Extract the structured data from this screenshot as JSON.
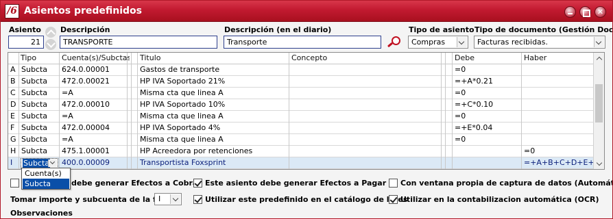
{
  "window": {
    "title": "Asientos predefinidos",
    "logo": "/6"
  },
  "header": {
    "asiento_label": "Asiento",
    "asiento_value": "21",
    "descripcion_label": "Descripción",
    "descripcion_value": "TRANSPORTE",
    "desc_diario_label": "Descripción (en el diario)",
    "desc_diario_value": "Transporte",
    "tipo_asiento_label": "Tipo de asiento",
    "tipo_asiento_value": "Compras",
    "tipo_doc_label": "Tipo de documento (Gestión Docs)",
    "tipo_doc_value": "Facturas recibidas."
  },
  "grid": {
    "columns": [
      "Tipo",
      "Cuenta(s)/Subctas.",
      "Titulo",
      "Concepto",
      "Debe",
      "Haber"
    ],
    "rows": [
      {
        "letter": "A",
        "tipo": "Subcta",
        "cuenta": "624.0.00001",
        "titulo": "Gastos de transporte",
        "concepto": "",
        "debe": "=0",
        "haber": ""
      },
      {
        "letter": "B",
        "tipo": "Subcta",
        "cuenta": "472.0.00021",
        "titulo": "HP IVA Soportado 21%",
        "concepto": "",
        "debe": "=+A*0.21",
        "haber": ""
      },
      {
        "letter": "C",
        "tipo": "Subcta",
        "cuenta": "=A",
        "titulo": "Misma cta que linea A",
        "concepto": "",
        "debe": "=0",
        "haber": ""
      },
      {
        "letter": "D",
        "tipo": "Subcta",
        "cuenta": "472.0.00010",
        "titulo": "HP IVA Soportado 10%",
        "concepto": "",
        "debe": "=+C*0.10",
        "haber": ""
      },
      {
        "letter": "E",
        "tipo": "Subcta",
        "cuenta": "=A",
        "titulo": "Misma cta que linea A",
        "concepto": "",
        "debe": "=0",
        "haber": ""
      },
      {
        "letter": "F",
        "tipo": "Subcta",
        "cuenta": "472.0.00004",
        "titulo": "HP IVA Soportado 4%",
        "concepto": "",
        "debe": "=+E*0.04",
        "haber": ""
      },
      {
        "letter": "G",
        "tipo": "Subcta",
        "cuenta": "=A",
        "titulo": "Misma cta que linea A",
        "concepto": "",
        "debe": "=0",
        "haber": ""
      },
      {
        "letter": "H",
        "tipo": "Subcta",
        "cuenta": "475.1.00001",
        "titulo": "HP Acreedora por retenciones",
        "concepto": "",
        "debe": "",
        "haber": "=0"
      },
      {
        "letter": "I",
        "tipo": "Subcta",
        "cuenta": "400.0.00009",
        "titulo": "Transportista Foxsprint",
        "concepto": "",
        "debe": "",
        "haber": "=+A+B+C+D+E+F"
      }
    ],
    "dropdown_options": [
      "Cuenta(s)",
      "Subcta"
    ]
  },
  "options": {
    "efectos_cobrar": {
      "label": "debe generar Efectos a Cobrar",
      "checked": false
    },
    "efectos_pagar": {
      "label": "Este asiento debe generar Efectos a Pagar",
      "checked": true
    },
    "ventana_propia": {
      "label": "Con ventana propia de captura de datos (Automático)",
      "checked": false
    },
    "tomar_importe_label": "Tomar importe y subcuenta de la fila",
    "tomar_importe_value": "I",
    "catalogo_lotes": {
      "label": "Utilizar este predefinido en el catálogo de lotes",
      "checked": true
    },
    "contabilizacion_ocr": {
      "label": "Utilizar en la contabilizacion automática (OCR)",
      "checked": true
    },
    "observaciones_label": "Observaciones"
  }
}
